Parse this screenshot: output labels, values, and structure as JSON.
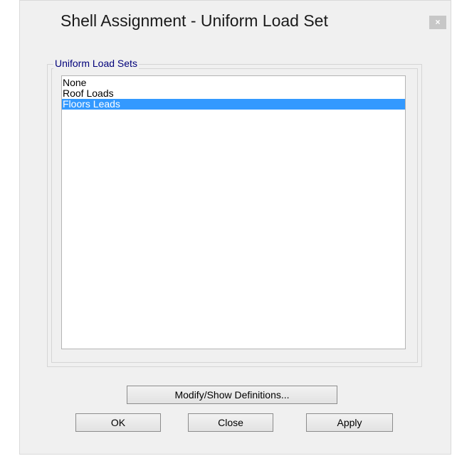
{
  "window": {
    "title": "Shell Assignment - Uniform Load Set",
    "close_glyph": "×"
  },
  "group": {
    "label": "Uniform Load Sets"
  },
  "list": {
    "items": [
      "None",
      "Roof Loads",
      "Floors Leads"
    ],
    "selected_index": 2
  },
  "buttons": {
    "modify": "Modify/Show Definitions...",
    "ok": "OK",
    "close": "Close",
    "apply": "Apply"
  },
  "colors": {
    "selection": "#3399ff",
    "group_label": "#00007a"
  }
}
